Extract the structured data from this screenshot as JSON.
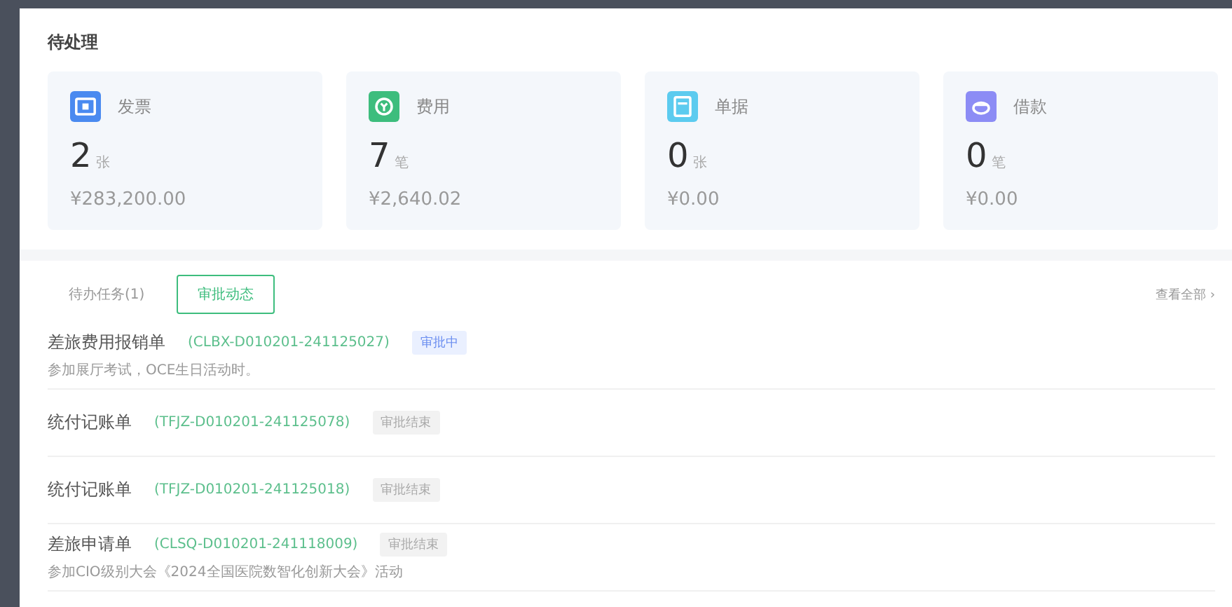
{
  "section_title": "待处理",
  "cards": [
    {
      "kind": "invoice",
      "label": "发票",
      "count": "2",
      "unit": "张",
      "amount": "¥283,200.00",
      "color": "#4a8af0"
    },
    {
      "kind": "expense",
      "label": "费用",
      "count": "7",
      "unit": "笔",
      "amount": "¥2,640.02",
      "color": "#3dbd7d"
    },
    {
      "kind": "document",
      "label": "单据",
      "count": "0",
      "unit": "张",
      "amount": "¥0.00",
      "color": "#5ccbef"
    },
    {
      "kind": "loan",
      "label": "借款",
      "count": "0",
      "unit": "笔",
      "amount": "¥0.00",
      "color": "#8c8cf5"
    }
  ],
  "tabs": [
    {
      "label": "待办任务(1)",
      "selected": false
    },
    {
      "label": "审批动态",
      "selected": true
    }
  ],
  "view_all": "查看全部 ›",
  "rows": [
    {
      "title": "差旅费用报销单",
      "code": "(CLBX-D010201-241125027)",
      "status": "审批中",
      "kind": "active",
      "note": "参加展厅考试，OCE生日活动时。"
    },
    {
      "title": "统付记账单",
      "code": "(TFJZ-D010201-241125078)",
      "status": "审批结束",
      "kind": "done"
    },
    {
      "title": "统付记账单",
      "code": "(TFJZ-D010201-241125018)",
      "status": "审批结束",
      "kind": "done"
    },
    {
      "title": "差旅申请单",
      "code": "(CLSQ-D010201-241118009)",
      "status": "审批结束",
      "kind": "done",
      "note": "参加CIO级别大会《2024全国医院数智化创新大会》活动"
    }
  ]
}
